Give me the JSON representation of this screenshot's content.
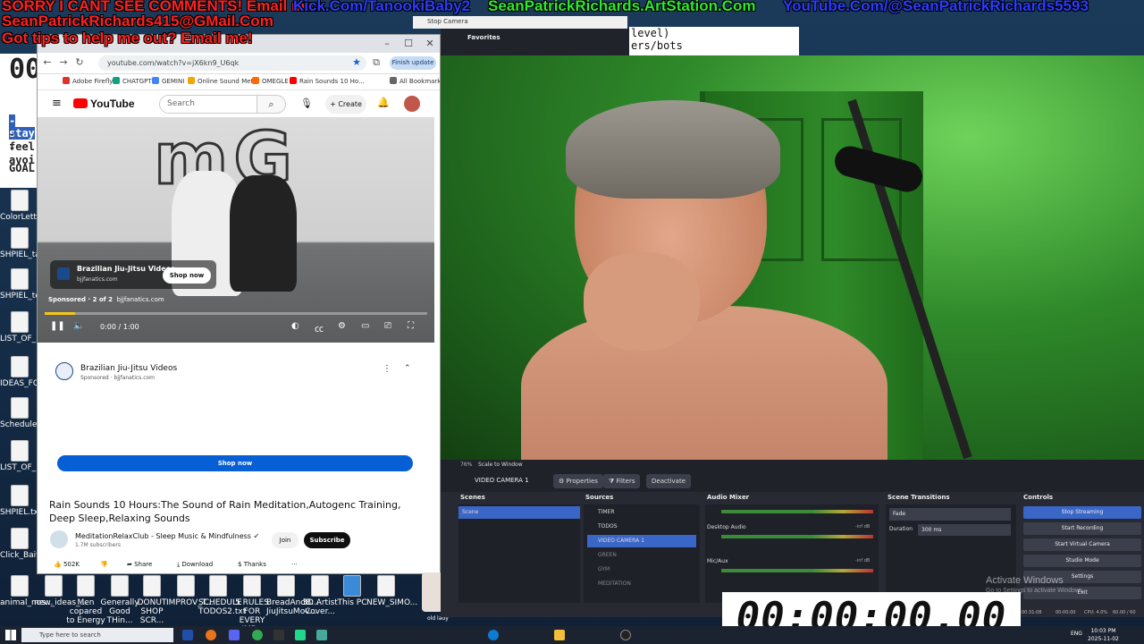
{
  "overlay": {
    "line1_red": "SORRY I CANT SEE COMMENTS! Email me:",
    "line1_kick": "Kick.Com/TanookiBaby2",
    "line1_art": "SeanPatrickRichards.ArtStation.Com",
    "line1_yt": "YouTube.Com/@SeanPatrickRichards5593",
    "line2": "SeanPatrickRichards415@GMail.Com",
    "line3": "Got tips to help me out? Email me!",
    "colors": {
      "red": "#ff2020",
      "blue": "#2a3cff",
      "green": "#2fe82f"
    }
  },
  "editor": {
    "timer_digits": "00",
    "lines": [
      "-stay",
      "-feel",
      "-avoi",
      "GOAL:"
    ]
  },
  "top_note": {
    "line1": "level)",
    "line2": "ers/bots"
  },
  "stop_camera_title": "Stop Camera",
  "favorites_label": "Favorites",
  "browser": {
    "url": "youtube.com/watch?v=jX6kn9_U6qk",
    "finish_update": "Finish update",
    "bookmarks": [
      "Adobe Firefly",
      "CHATGPT",
      "GEMINI",
      "Online Sound Meter",
      "OMEGLE",
      "Rain Sounds 10 Ho...",
      "All Bookmarks"
    ],
    "bookmark_colors": [
      "#e0312b",
      "#10a37f",
      "#4285f4",
      "#f2a600",
      "#ff6a00",
      "#ff0000",
      "#666666"
    ],
    "youtube": {
      "logo": "YouTube",
      "search_placeholder": "Search",
      "create": "Create"
    },
    "video": {
      "ad_title": "Brazilian Jiu-Jitsu Videos",
      "ad_domain": "bjjfanatics.com",
      "shop_now": "Shop now",
      "sponsored": "Sponsored · 2 of 2",
      "sponsored_domain": "bjjfanatics.com",
      "time": "0:00 / 1:00",
      "progress": 0.08
    },
    "ad_panel": {
      "name": "Brazilian Jiu-Jitsu Videos",
      "sponsored": "Sponsored · bjjfanatics.com",
      "shop_now": "Shop now"
    },
    "title": "Rain Sounds 10 Hours:The Sound of Rain Meditation,Autogenc Training, Deep Sleep,Relaxing Sounds",
    "channel": "MeditationRelaxClub - Sleep Music & Mindfulness",
    "subscribers": "1.7M subscribers",
    "join": "Join",
    "subscribe": "Subscribe",
    "actions": {
      "likes": "502K",
      "share": "Share",
      "download": "Download",
      "thanks": "Thanks",
      "more": "···"
    }
  },
  "desktop_icons_left": [
    "ColorLette...",
    "SHPIEL_ta...",
    "SHPIEL_te...",
    "LIST_OF_R...",
    "IDEAS_FOR...",
    "Schedule.txt",
    "LIST_OF_R...",
    "SHPIEL.txt",
    "Click_Bait_..."
  ],
  "desktop_icons_bottom": [
    "animal_nos...",
    "new_ideas_...",
    "Men copared to Energy a...",
    "Generally Good THin...",
    "DONUT SHOP SCR...",
    "IMPROV_T...",
    "SCHEDULE TODOS2.txt",
    "5 RULES FOR EVERY IMP...",
    "BreadAndB... JiuJitsuMov...",
    "3D Artist Cover...",
    "This PC",
    "NEW_SIMO..."
  ],
  "obs": {
    "zoom": "76%",
    "scale": "Scale to Window",
    "current_source": "VIDEO CAMERA 1",
    "properties": "Properties",
    "filters": "Filters",
    "deactivate": "Deactivate",
    "scenes_title": "Scenes",
    "scenes": [
      "Scene"
    ],
    "sources_title": "Sources",
    "sources": [
      "TIMER",
      "TODOS",
      "VIDEO CAMERA 1",
      "GREEN",
      "GYM",
      "MEDITATION"
    ],
    "mixer_title": "Audio Mixer",
    "mixer_channels": [
      "Desktop Audio",
      "Mic/Aux"
    ],
    "mixer_levels": [
      "-inf dB",
      "-inf dB"
    ],
    "transitions_title": "Scene Transitions",
    "transition": "Fade",
    "duration_label": "Duration",
    "duration": "300 ms",
    "controls_title": "Controls",
    "controls": [
      "Stop Streaming",
      "Start Recording",
      "Start Virtual Camera",
      "Studio Mode",
      "Settings",
      "Exit"
    ],
    "status_time": "00:31:08",
    "status_rec": "00:00:00",
    "cpu": "CPU: 4.0%",
    "fps": "60.00 / 60"
  },
  "timer_overlay": "00:00:00.00",
  "activate": {
    "title": "Activate Windows",
    "sub": "Go to Settings to activate Windows."
  },
  "chat_name": "old lady",
  "taskbar": {
    "search": "Type here to search",
    "lang": "ENG",
    "time": "10:03 PM",
    "date": "2025-11-02"
  }
}
